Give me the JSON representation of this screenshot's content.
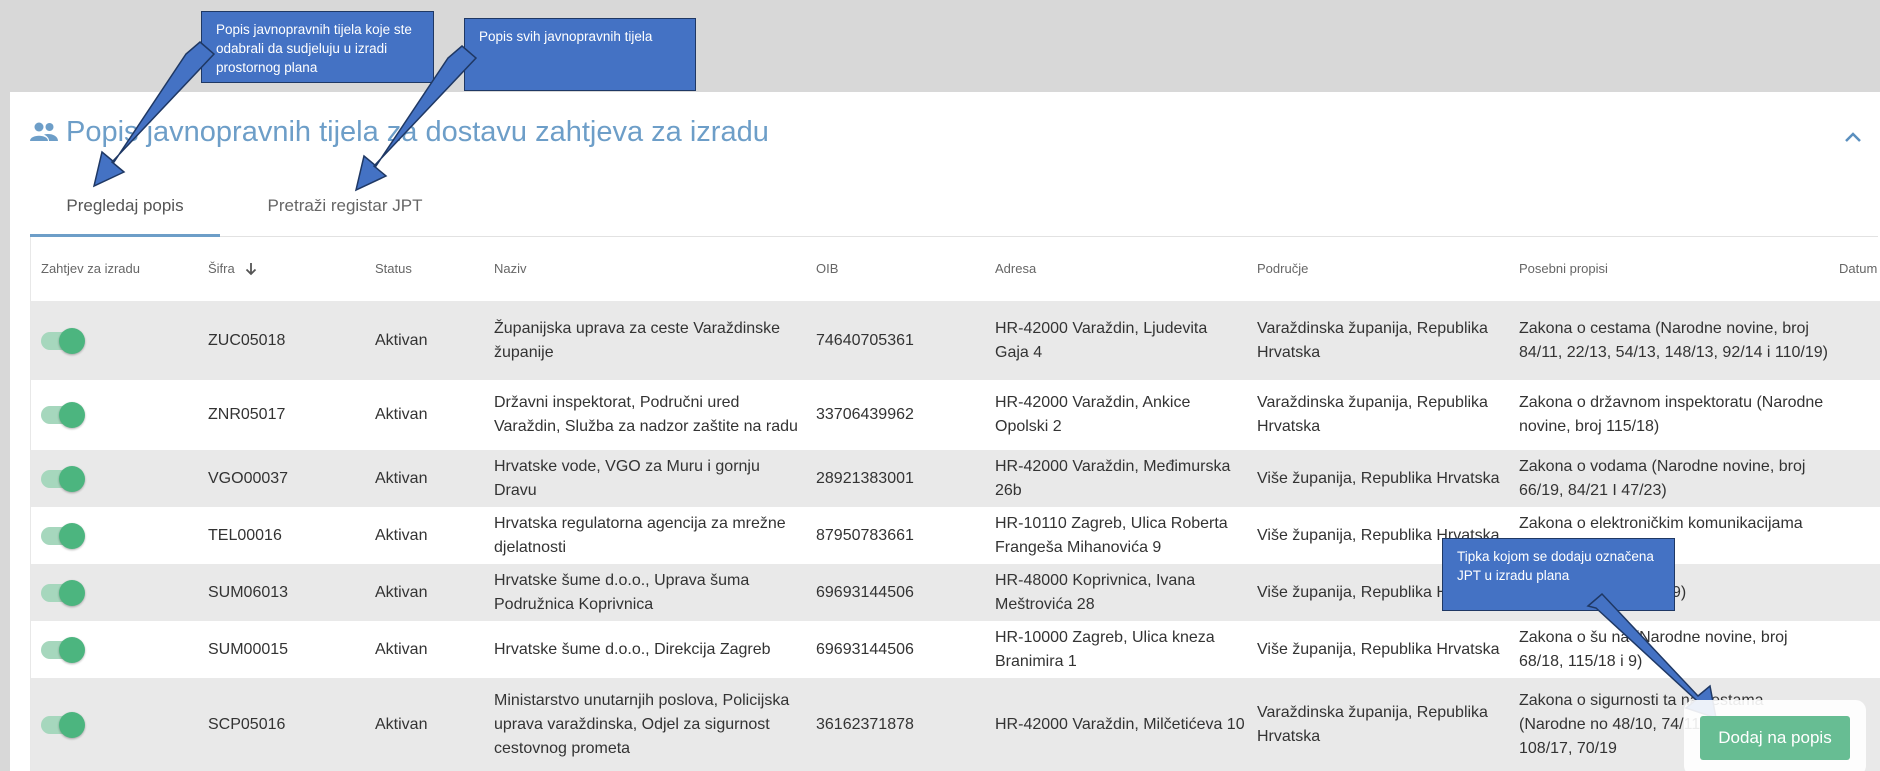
{
  "panel": {
    "title": "Popis javnopravnih tijela za dostavu zahtjeva za izradu",
    "title_icon": "people-icon",
    "collapse_icon": "chevron-up-icon"
  },
  "tabs": [
    {
      "label": "Pregledaj popis",
      "active": true
    },
    {
      "label": "Pretraži registar JPT",
      "active": false
    }
  ],
  "table": {
    "headers": [
      "Zahtjev za izradu",
      "Šifra",
      "Status",
      "Naziv",
      "OIB",
      "Adresa",
      "Područje",
      "Posebni propisi",
      "Datum"
    ],
    "sort_icon": "arrow-down-icon",
    "rows": [
      {
        "toggle_on": true,
        "sifra": "ZUC05018",
        "status": "Aktivan",
        "naziv": "Županijska uprava za ceste Varaždinske županije",
        "oib": "74640705361",
        "adresa": "HR-42000 Varaždin, Ljudevita Gaja 4",
        "podrucje": "Varaždinska županija, Republika Hrvatska",
        "propisi": "Zakona o cestama (Narodne novine, broj 84/11, 22/13, 54/13, 148/13, 92/14 i 110/19)"
      },
      {
        "toggle_on": true,
        "sifra": "ZNR05017",
        "status": "Aktivan",
        "naziv": "Državni inspektorat, Područni ured Varaždin, Služba za nadzor zaštite na radu",
        "oib": "33706439962",
        "adresa": "HR-42000 Varaždin, Ankice Opolski 2",
        "podrucje": "Varaždinska županija, Republika Hrvatska",
        "propisi": "Zakona o državnom inspektoratu (Narodne novine, broj 115/18)"
      },
      {
        "toggle_on": true,
        "sifra": "VGO00037",
        "status": "Aktivan",
        "naziv": "Hrvatske vode, VGO za Muru i gornju Dravu",
        "oib": "28921383001",
        "adresa": "HR-42000 Varaždin, Međimurska 26b",
        "podrucje": "Više županija, Republika Hrvatska",
        "propisi": "Zakona o vodama (Narodne novine, broj 66/19, 84/21 I 47/23)"
      },
      {
        "toggle_on": true,
        "sifra": "TEL00016",
        "status": "Aktivan",
        "naziv": "Hrvatska regulatorna agencija za mrežne djelatnosti",
        "oib": "87950783661",
        "adresa": "HR-10110 Zagreb, Ulica Roberta Frangeša Mihanovića 9",
        "podrucje": "Više županija, Republika Hrvatska",
        "propisi": "Zakona o elektroničkim komunikacijama 76/22)"
      },
      {
        "toggle_on": true,
        "sifra": "SUM06013",
        "status": "Aktivan",
        "naziv": "Hrvatske šume d.o.o., Uprava šuma Podružnica Koprivnica",
        "oib": "69693144506",
        "adresa": "HR-48000 Koprivnica, Ivana Meštrovića 28",
        "podrucje": "Više županija, Republika Hrvatska",
        "propisi": "Narodne novine, broj 9)"
      },
      {
        "toggle_on": true,
        "sifra": "SUM00015",
        "status": "Aktivan",
        "naziv": "Hrvatske šume d.o.o., Direkcija Zagreb",
        "oib": "69693144506",
        "adresa": "HR-10000 Zagreb, Ulica kneza Branimira 1",
        "podrucje": "Više županija, Republika Hrvatska",
        "propisi": "Zakona o šu na (Narodne novine, broj 68/18, 115/18 i 9)"
      },
      {
        "toggle_on": true,
        "sifra": "SCP05016",
        "status": "Aktivan",
        "naziv": "Ministarstvo unutarnjih poslova, Policijska uprava varaždinska, Odjel za sigurnost cestovnog prometa",
        "oib": "36162371878",
        "adresa": "HR-42000 Varaždin, Milčetićeva 10",
        "podrucje": "Varaždinska županija, Republika Hrvatska",
        "propisi": "Zakona o sigurnosti ta na cestama (Narodne no 48/10, 74/11, 80/13, 1 64/15, 108/17, 70/19"
      }
    ]
  },
  "callouts": {
    "c1": "Popis javnopravnih tijela koje ste odabrali da sudjeluju u izradi prostornog plana",
    "c2": "Popis svih javnopravnih tijela",
    "c3": "Tipka kojom se dodaju označena JPT u izradu plana"
  },
  "add_button": "Dodaj na popis",
  "colors": {
    "accent": "#6d9ec8",
    "toggle": "#4cb57f",
    "button": "#67bd93",
    "callout": "#4472c4"
  }
}
